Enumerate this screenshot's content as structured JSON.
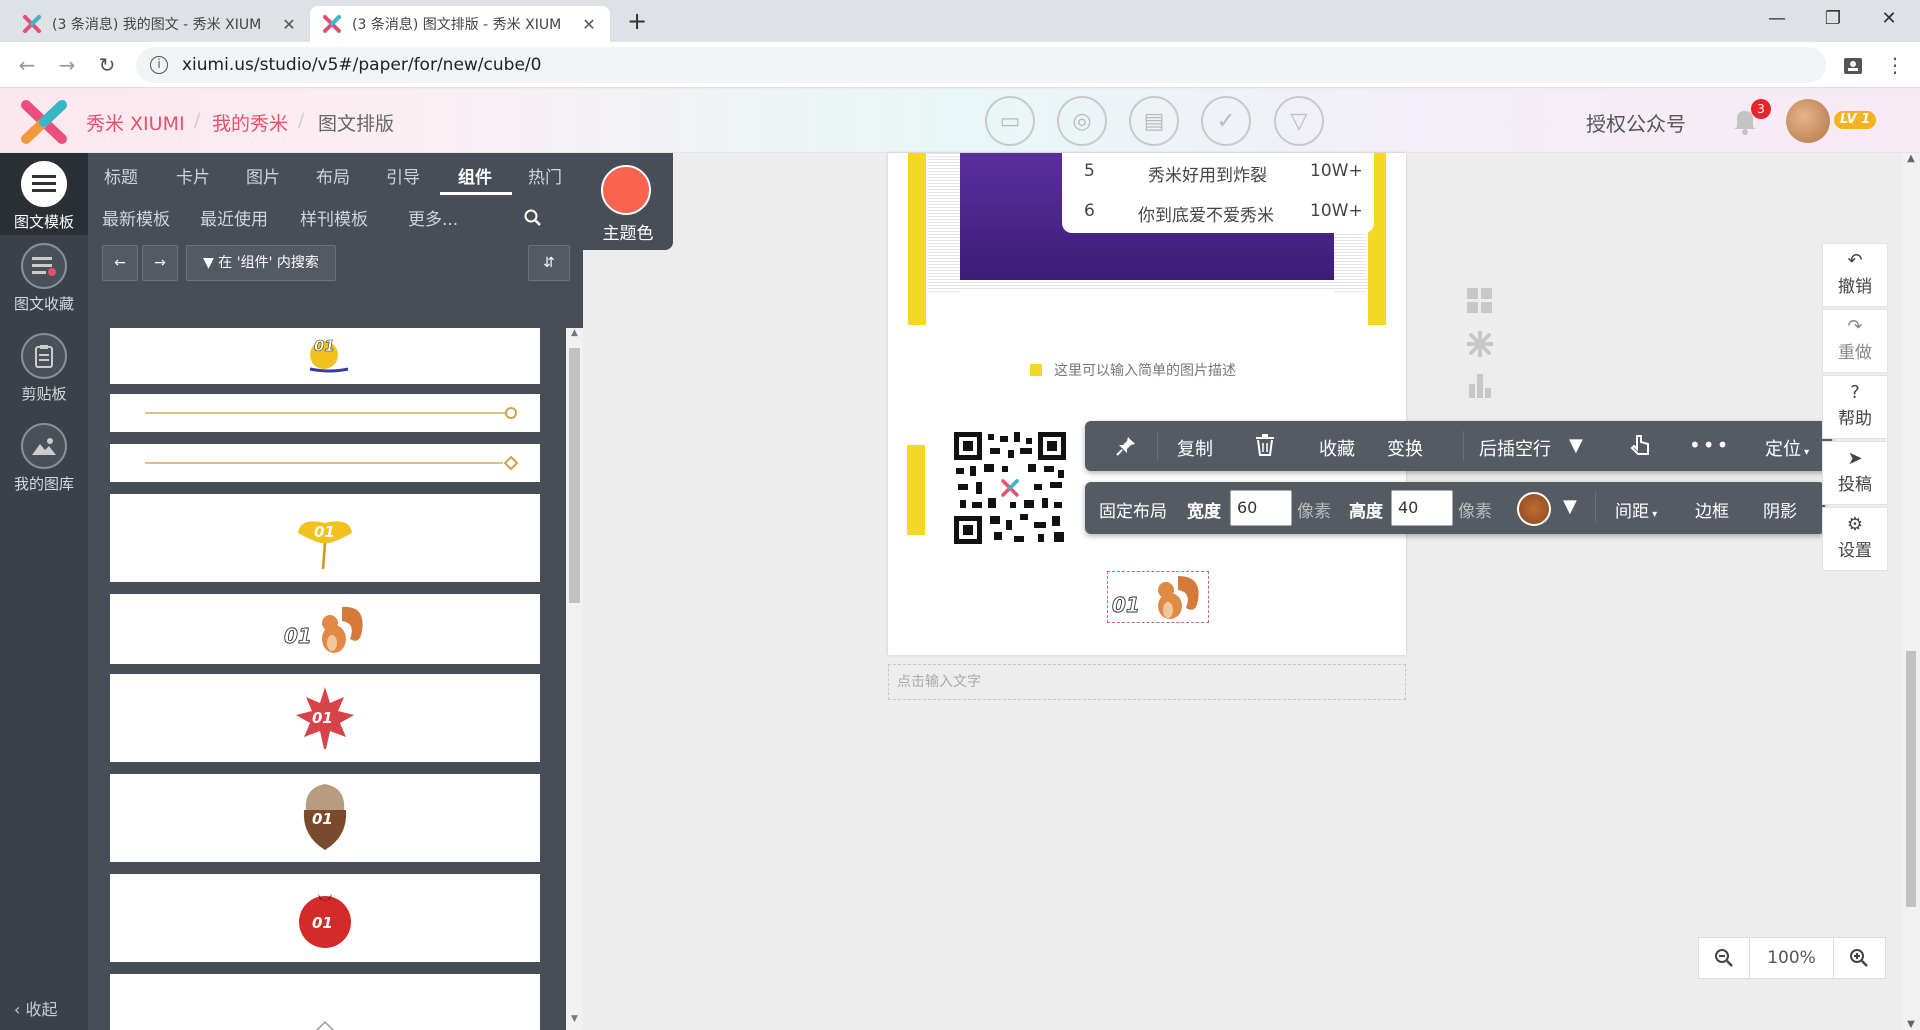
{
  "browser": {
    "tabs": [
      {
        "title": "(3 条消息) 我的图文 - 秀米 XIUM"
      },
      {
        "title": "(3 条消息) 图文排版 - 秀米 XIUM"
      }
    ],
    "new_tab": "+",
    "url": "xiumi.us/studio/v5#/paper/for/new/cube/0",
    "window": {
      "minimize": "—",
      "maximize": "❐",
      "close": "✕"
    }
  },
  "header": {
    "brand": "秀米 XIUMI",
    "breadcrumb": [
      "我的秀米",
      "图文排版"
    ],
    "auth_label": "授权公众号",
    "notification_count": "3",
    "level": "LV 1"
  },
  "rail": {
    "items": [
      "图文模板",
      "图文收藏",
      "剪贴板",
      "我的图库"
    ],
    "collapse": "收起"
  },
  "panel": {
    "tabs": [
      "标题",
      "卡片",
      "图片",
      "布局",
      "引导",
      "组件",
      "热门"
    ],
    "subtabs": [
      "最新模板",
      "最近使用",
      "样刊模板",
      "更多..."
    ],
    "search_scope": "在 '组件' 内搜索",
    "theme_label": "主题色",
    "theme_color": "#f8644f",
    "templates": [
      "01",
      "",
      "",
      "01",
      "01",
      "01",
      "01",
      "01",
      ""
    ]
  },
  "canvas": {
    "rows": [
      {
        "rank": "5",
        "title": "秀米好用到炸裂",
        "count": "10W+"
      },
      {
        "rank": "6",
        "title": "你到底爱不爱秀米",
        "count": "10W+"
      }
    ],
    "caption": "这里可以输入简单的图片描述",
    "selected_label": "01",
    "text_placeholder": "点击输入文字"
  },
  "toolbar1": {
    "copy": "复制",
    "collect": "收藏",
    "transform": "变换",
    "insert_after": "后插空行",
    "more": "•••",
    "position": "定位"
  },
  "toolbar2": {
    "fixed_layout": "固定布局",
    "width_label": "宽度",
    "width_value": "60",
    "unit1": "像素",
    "height_label": "高度",
    "height_value": "40",
    "unit2": "像素",
    "spacing": "间距",
    "border": "边框",
    "shadow": "阴影"
  },
  "right_panel": [
    "撤销",
    "重做",
    "帮助",
    "投稿",
    "设置"
  ],
  "zoom": {
    "level": "100%"
  }
}
